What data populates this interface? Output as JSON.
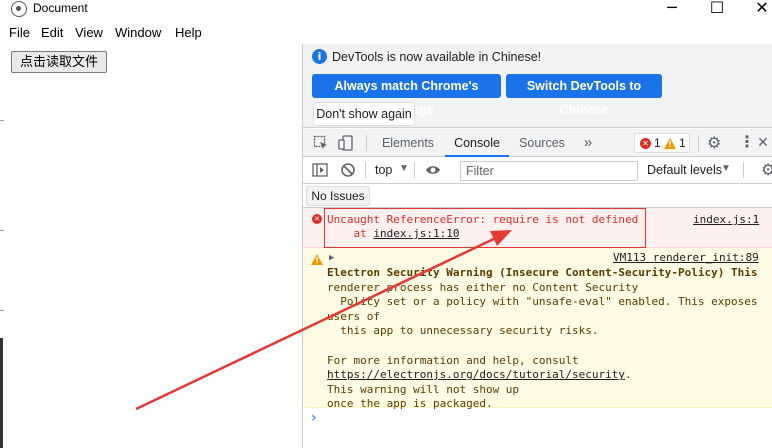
{
  "window": {
    "title": "Document",
    "minimize": "─",
    "maximize": "☐",
    "close": "✕"
  },
  "menu": [
    "File",
    "Edit",
    "View",
    "Window",
    "Help"
  ],
  "app": {
    "read_button": "点击读取文件"
  },
  "devtools": {
    "info_text": "DevTools is now available in Chinese!",
    "btn_match_language": "Always match Chrome's language",
    "btn_switch_chinese": "Switch DevTools to Chinese",
    "btn_dont_show": "Don't show again",
    "tabs": [
      "Elements",
      "Console",
      "Sources"
    ],
    "more_tabs": "»",
    "error_count": "1",
    "warning_count": "1",
    "toolbar": {
      "context": "top",
      "filter_placeholder": "Filter",
      "levels": "Default levels"
    },
    "no_issues": "No Issues",
    "error_message": {
      "line1": "Uncaught ReferenceError: require is not defined",
      "line2_prefix": "    at ",
      "line2_link": "index.js:1:10",
      "source": "index.js:1"
    },
    "warning_message": {
      "source": "VM113 renderer_init:89",
      "lines": [
        "Electron Security Warning (Insecure Content-Security-Policy) This",
        "renderer process has either no Content Security",
        "  Policy set or a policy with \"unsafe-eval\" enabled. This exposes",
        "users of",
        "  this app to unnecessary security risks.",
        "",
        "For more information and help, consult"
      ],
      "link": "https://electronjs.org/docs/tutorial/security",
      "link_suffix": ".",
      "tail": [
        "This warning will not show up",
        "once the app is packaged."
      ]
    },
    "prompt": "›"
  },
  "colors": {
    "accent": "#1a73e8",
    "error": "#d93025",
    "warning": "#f29900",
    "annotation": "#e53935"
  }
}
